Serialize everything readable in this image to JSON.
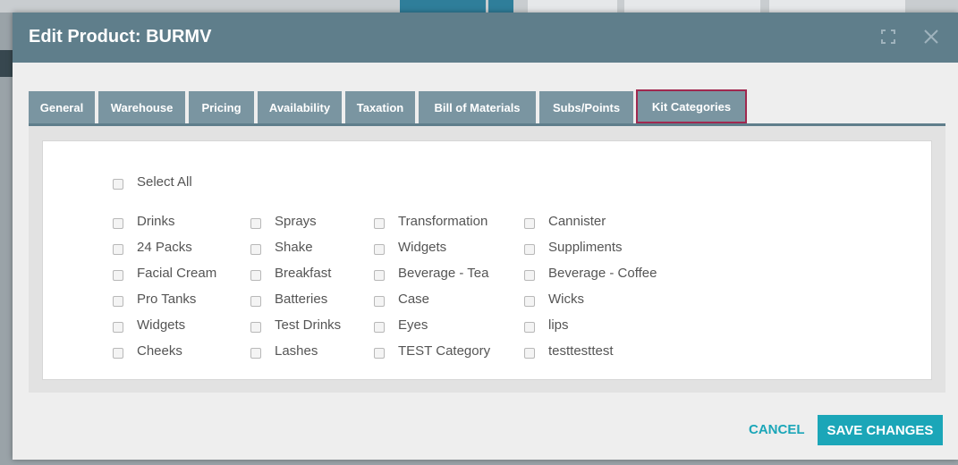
{
  "modal": {
    "title": "Edit Product: BURMV",
    "expand_icon": "expand-icon",
    "close_icon": "close-icon"
  },
  "tabs": [
    {
      "label": "General"
    },
    {
      "label": "Warehouse"
    },
    {
      "label": "Pricing"
    },
    {
      "label": "Availability"
    },
    {
      "label": "Taxation"
    },
    {
      "label": "Bill of Materials"
    },
    {
      "label": "Subs/Points"
    },
    {
      "label": "Kit Categories",
      "active": true
    }
  ],
  "kit_categories": {
    "select_all_label": "Select All",
    "columns": [
      [
        "Drinks",
        "24 Packs",
        "Facial Cream",
        "Pro Tanks",
        "Widgets",
        "Cheeks"
      ],
      [
        "Sprays",
        "Shake",
        "Breakfast",
        "Batteries",
        "Test Drinks",
        "Lashes"
      ],
      [
        "Transformation",
        "Widgets",
        "Beverage - Tea",
        "Case",
        "Eyes",
        "TEST Category"
      ],
      [
        "Cannister",
        "Suppliments",
        "Beverage - Coffee",
        "Wicks",
        "lips",
        "testtesttest"
      ]
    ]
  },
  "footer": {
    "cancel_label": "CANCEL",
    "save_label": "SAVE CHANGES"
  },
  "colors": {
    "header": "#5f7e8b",
    "tab": "#7a95a1",
    "active_tab_border": "#a0284f",
    "accent": "#1ba6b8"
  }
}
